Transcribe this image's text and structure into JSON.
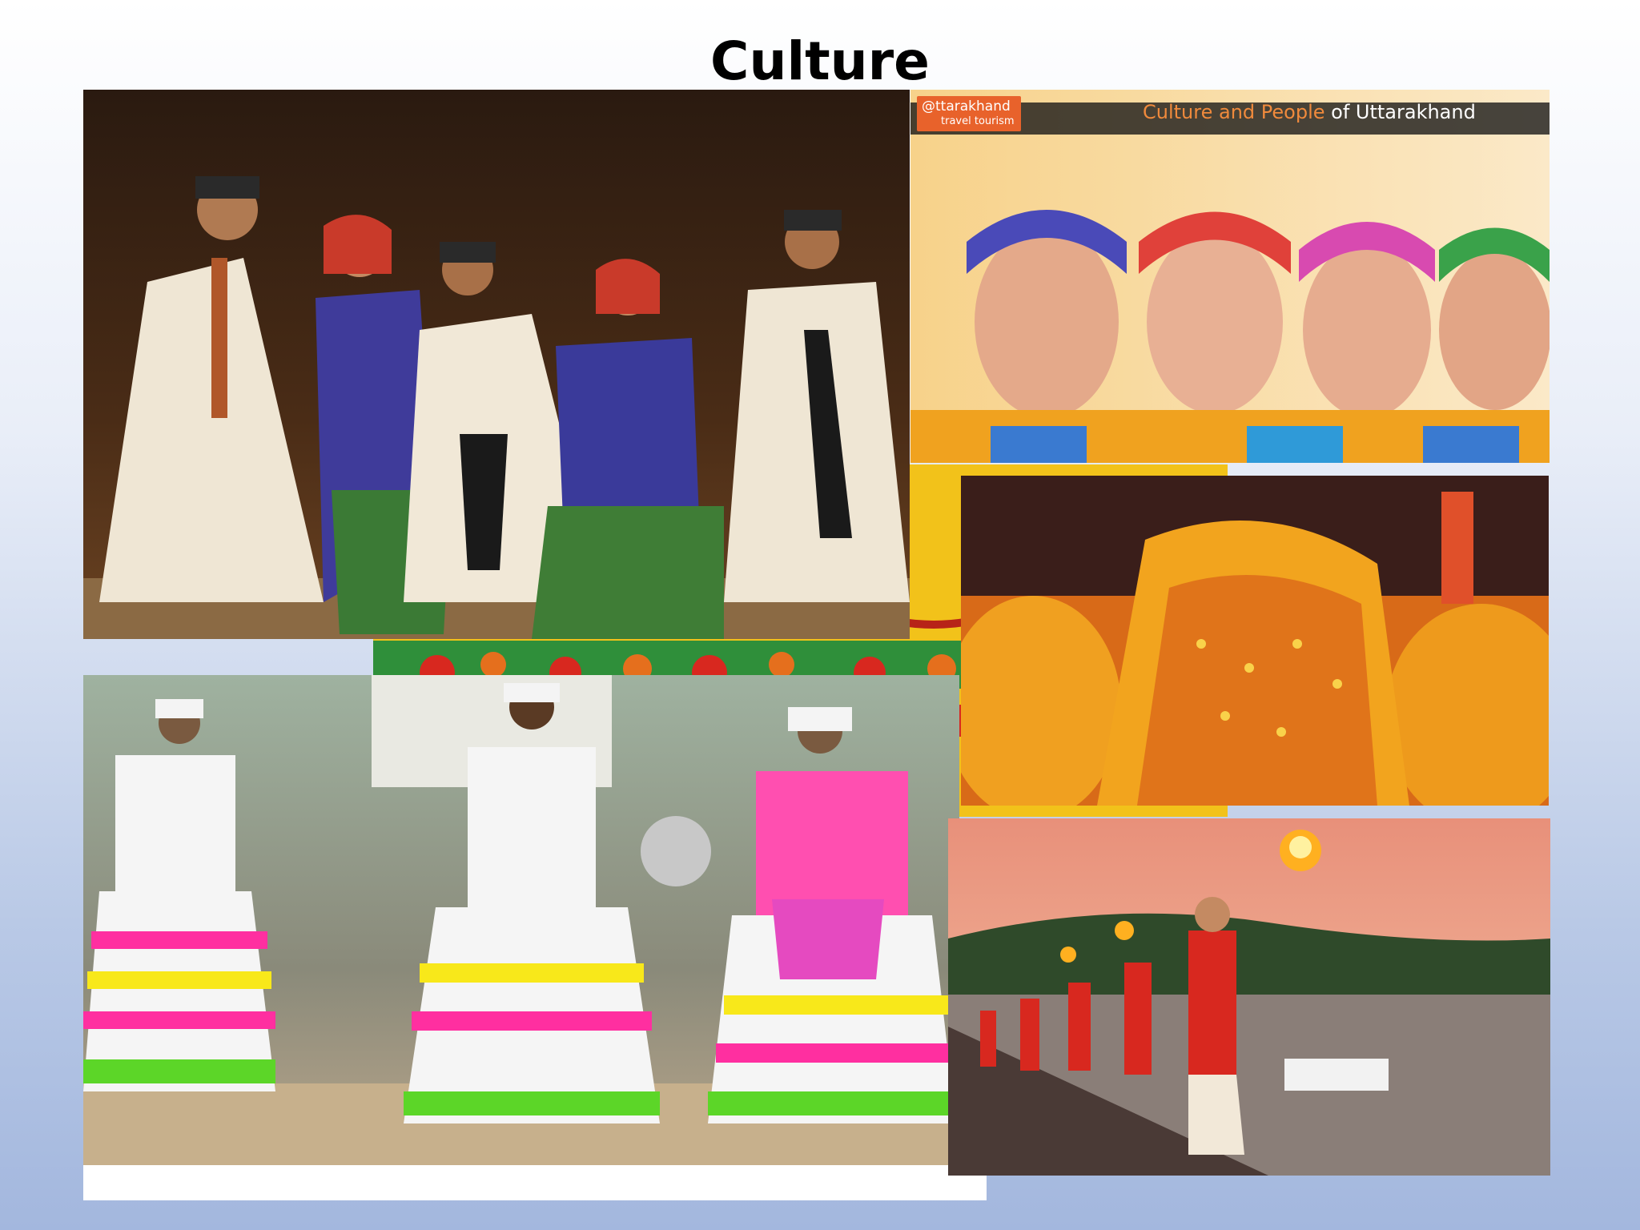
{
  "slide": {
    "title": "Culture"
  },
  "photos": {
    "top_left": {},
    "top_right": {
      "brand_line1": "@ttarakhand",
      "brand_line2": "travel tourism",
      "caption_orange": "Culture and People",
      "caption_white": " of Uttarakhand"
    },
    "middle_right": {},
    "bottom_left": {},
    "bottom_right": {}
  }
}
